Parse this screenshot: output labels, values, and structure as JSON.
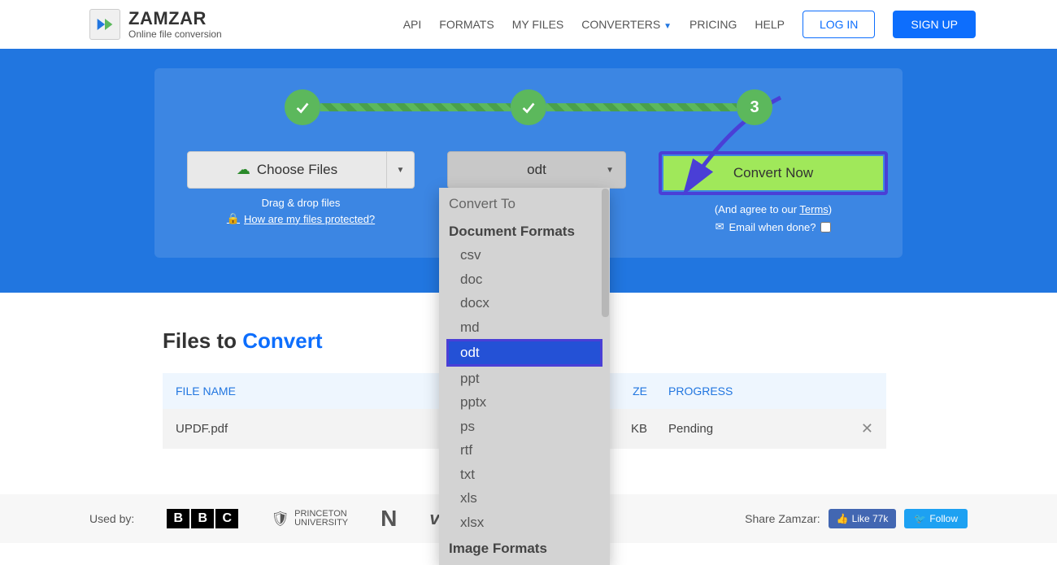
{
  "header": {
    "brand": "ZAMZAR",
    "tagline": "Online file conversion",
    "nav": {
      "api": "API",
      "formats": "FORMATS",
      "myfiles": "MY FILES",
      "converters": "CONVERTERS",
      "pricing": "PRICING",
      "help": "HELP"
    },
    "login": "LOG IN",
    "signup": "SIGN UP"
  },
  "steps": {
    "step3": "3"
  },
  "stage1": {
    "choose": "Choose Files",
    "dragdrop": "Drag & drop files",
    "protected": "How are my files protected?"
  },
  "stage2": {
    "selected": "odt"
  },
  "stage3": {
    "convert": "Convert Now",
    "agree_prefix": "(And agree to our ",
    "agree_link": "Terms",
    "agree_suffix": ")",
    "email": "Email when done?"
  },
  "dropdown": {
    "header": "Convert To",
    "group1_title": "Document Formats",
    "items1": [
      "csv",
      "doc",
      "docx",
      "md",
      "odt",
      "ppt",
      "pptx",
      "ps",
      "rtf",
      "txt",
      "xls",
      "xlsx"
    ],
    "group2_title": "Image Formats"
  },
  "files": {
    "title_prefix": "Files to ",
    "title_accent": "Convert",
    "columns": {
      "name": "FILE NAME",
      "size": "ZE",
      "progress": "PROGRESS"
    },
    "rows": [
      {
        "name": "UPDF.pdf",
        "size": "KB",
        "progress": "Pending"
      }
    ]
  },
  "footer": {
    "usedby": "Used by:",
    "princeton_line1": "PRINCETON",
    "princeton_line2": "UNIVERSITY",
    "netflix": "N",
    "discovery": "very",
    "share_label": "Share Zamzar:",
    "fb": "Like 77k",
    "tw": "Follow"
  }
}
